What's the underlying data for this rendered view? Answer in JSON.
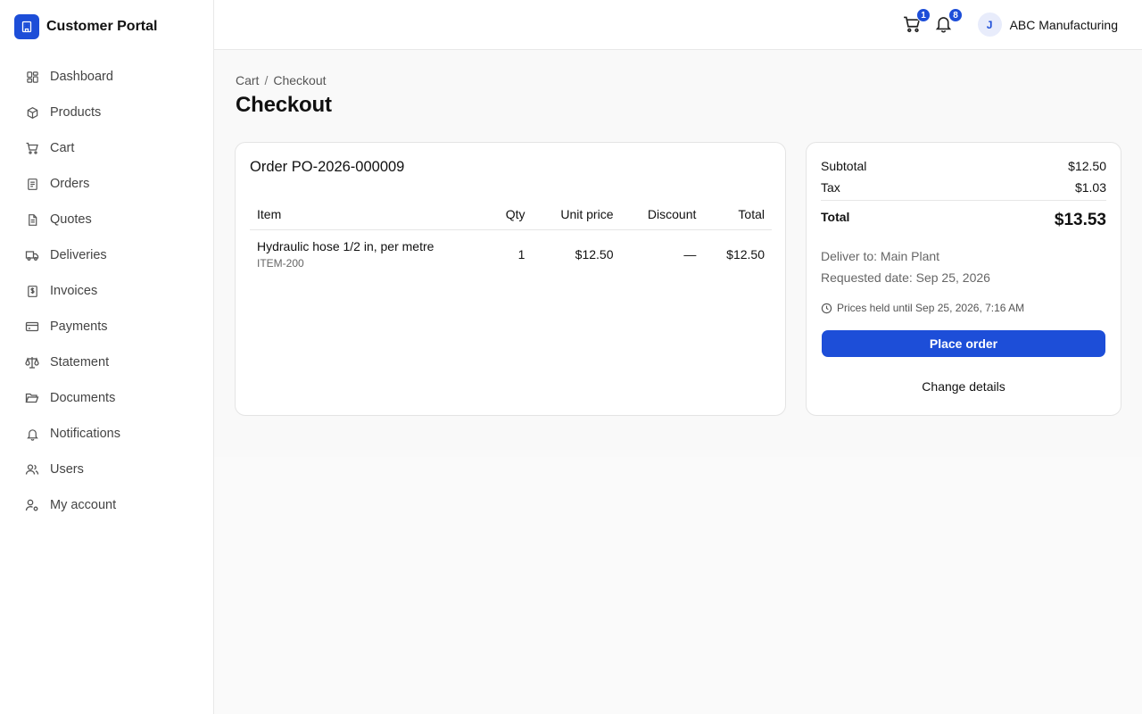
{
  "brand": {
    "name": "Customer Portal",
    "icon": "building-icon",
    "accent": "#1d4ed8"
  },
  "sidebar": {
    "items": [
      {
        "label": "Dashboard",
        "icon": "dashboard-icon"
      },
      {
        "label": "Products",
        "icon": "box-icon"
      },
      {
        "label": "Cart",
        "icon": "cart-icon"
      },
      {
        "label": "Orders",
        "icon": "orders-icon"
      },
      {
        "label": "Quotes",
        "icon": "quote-icon"
      },
      {
        "label": "Deliveries",
        "icon": "truck-icon"
      },
      {
        "label": "Invoices",
        "icon": "invoice-icon"
      },
      {
        "label": "Payments",
        "icon": "credit-card-icon"
      },
      {
        "label": "Statement",
        "icon": "scale-icon"
      },
      {
        "label": "Documents",
        "icon": "folder-icon"
      },
      {
        "label": "Notifications",
        "icon": "bell-icon"
      },
      {
        "label": "Users",
        "icon": "users-icon"
      },
      {
        "label": "My account",
        "icon": "user-cog-icon"
      }
    ]
  },
  "header": {
    "cart_count": "1",
    "notification_count": "8",
    "user_initial": "J",
    "user_name": "ABC Manufacturing"
  },
  "breadcrumb": {
    "parent": "Cart",
    "separator": "/",
    "current": "Checkout"
  },
  "page": {
    "title": "Checkout"
  },
  "order": {
    "title": "Order PO-2026-000009",
    "columns": {
      "item": "Item",
      "qty": "Qty",
      "unit_price": "Unit price",
      "discount": "Discount",
      "total": "Total"
    },
    "rows": [
      {
        "name": "Hydraulic hose 1/2 in, per metre",
        "sku": "ITEM-200",
        "qty": "1",
        "unit_price": "$12.50",
        "discount": "—",
        "total": "$12.50"
      }
    ]
  },
  "summary": {
    "subtotal_label": "Subtotal",
    "subtotal": "$12.50",
    "tax_label": "Tax",
    "tax": "$1.03",
    "total_label": "Total",
    "total": "$13.53",
    "deliver_to": "Deliver to: Main Plant",
    "requested_date": "Requested date: Sep 25, 2026",
    "prices_held": "Prices held until Sep 25, 2026, 7:16 AM",
    "place_order": "Place order",
    "change_details": "Change details"
  }
}
